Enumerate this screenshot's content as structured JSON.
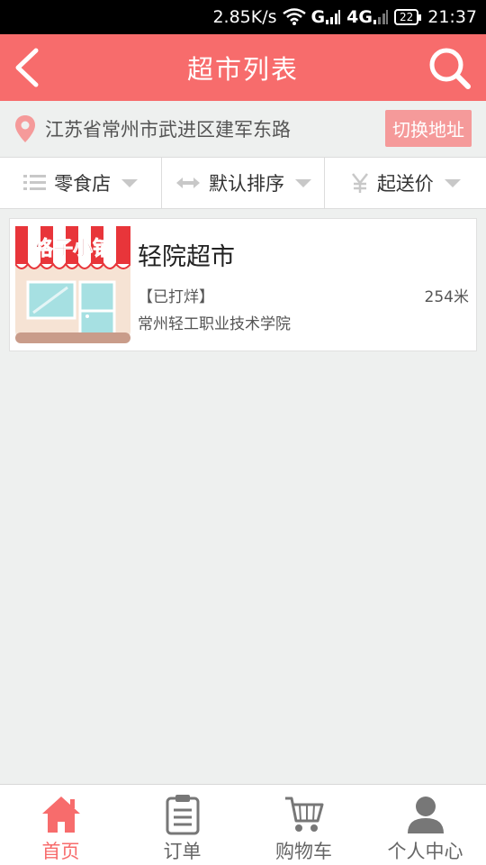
{
  "status_bar": {
    "speed": "2.85K/s",
    "network1": "G",
    "network2": "4G",
    "battery": "22",
    "time": "21:37"
  },
  "header": {
    "title": "超市列表"
  },
  "address": {
    "text": "江苏省常州市武进区建军东路",
    "switch_label": "切换地址"
  },
  "filters": [
    {
      "label": "零食店",
      "icon": "list-icon"
    },
    {
      "label": "默认排序",
      "icon": "sort-icon"
    },
    {
      "label": "起送价",
      "icon": "yen-icon"
    }
  ],
  "stores": [
    {
      "name": "轻院超市",
      "status": "【已打烊】",
      "distance": "254米",
      "school": "常州轻工职业技术学院",
      "logo_text": "格子小铺"
    }
  ],
  "tabs": [
    {
      "label": "首页",
      "icon": "home-icon",
      "active": true
    },
    {
      "label": "订单",
      "icon": "order-icon",
      "active": false
    },
    {
      "label": "购物车",
      "icon": "cart-icon",
      "active": false
    },
    {
      "label": "个人中心",
      "icon": "user-icon",
      "active": false
    }
  ],
  "colors": {
    "accent": "#f76c6c",
    "switch_button": "#f59a9a",
    "background": "#eef0ef"
  }
}
